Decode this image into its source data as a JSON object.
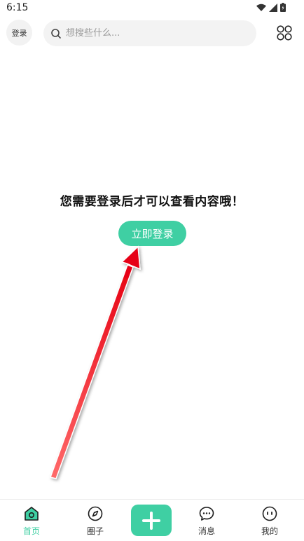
{
  "status_bar": {
    "time": "6:15"
  },
  "header": {
    "login_label": "登录",
    "search_placeholder": "想搜些什么..."
  },
  "main": {
    "prompt": "您需要登录后才可以查看内容哦！",
    "login_button": "立即登录"
  },
  "bottom_nav": {
    "items": [
      {
        "label": "首页",
        "icon": "home-icon",
        "active": true
      },
      {
        "label": "圈子",
        "icon": "compass-icon",
        "active": false
      },
      {
        "label": "",
        "icon": "plus-icon",
        "active": false
      },
      {
        "label": "消息",
        "icon": "chat-icon",
        "active": false
      },
      {
        "label": "我的",
        "icon": "face-icon",
        "active": false
      }
    ]
  },
  "colors": {
    "accent": "#3fcfa3",
    "annotation_arrow": "#e60012"
  }
}
